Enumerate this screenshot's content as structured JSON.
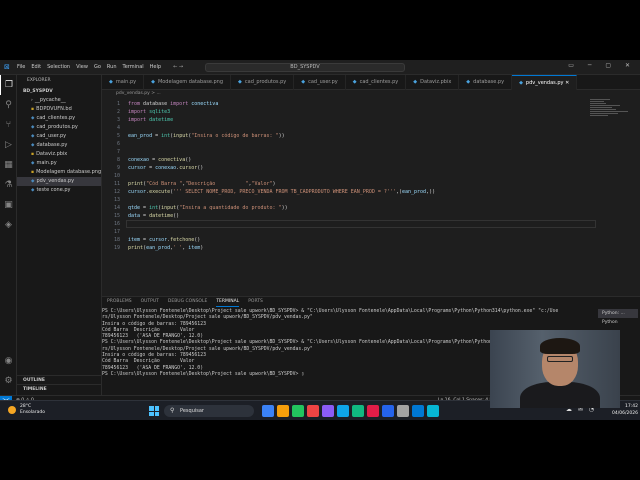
{
  "titlebar": {
    "logo": "⊠",
    "menu": [
      "File",
      "Edit",
      "Selection",
      "View",
      "Go",
      "Run",
      "Terminal",
      "Help"
    ],
    "nav": "←  →",
    "search": "BD_SYSPDV",
    "winctl": "▭ ─ ▢ ✕"
  },
  "activity": {
    "icons": [
      "files-icon",
      "search-icon",
      "source-control-icon",
      "run-debug-icon",
      "extensions-icon",
      "test-icon",
      "remote-icon",
      "docker-icon"
    ],
    "bottom": [
      "account-icon",
      "settings-icon"
    ]
  },
  "sidebar": {
    "header": "EXPLORER",
    "root": "BD_SYSPDV",
    "files": [
      {
        "name": "__pycache__",
        "icon": "›",
        "active": false
      },
      {
        "name": "BDPDVUFN.bd",
        "icon": "▪",
        "active": false
      },
      {
        "name": "cad_clientes.py",
        "icon": "◆",
        "active": false
      },
      {
        "name": "cad_produtos.py",
        "icon": "◆",
        "active": false
      },
      {
        "name": "cad_user.py",
        "icon": "◆",
        "active": false
      },
      {
        "name": "database.py",
        "icon": "◆",
        "active": false
      },
      {
        "name": "Dataviz.pbix",
        "icon": "▪",
        "active": false
      },
      {
        "name": "main.py",
        "icon": "◆",
        "active": false
      },
      {
        "name": "Modelagem database.png",
        "icon": "▪",
        "active": false
      },
      {
        "name": "pdv_vendas.py",
        "icon": "◆",
        "active": true
      },
      {
        "name": "teste cone.py",
        "icon": "◆",
        "active": false
      }
    ],
    "outline": "OUTLINE",
    "timeline": "TIMELINE"
  },
  "tabs": [
    {
      "label": "main.py",
      "active": false
    },
    {
      "label": "Modelagem database.png",
      "active": false
    },
    {
      "label": "cad_produtos.py",
      "active": false
    },
    {
      "label": "cad_user.py",
      "active": false
    },
    {
      "label": "cad_clientes.py",
      "active": false
    },
    {
      "label": "Dataviz.pbix",
      "active": false
    },
    {
      "label": "database.py",
      "active": false
    },
    {
      "label": "pdv_vendas.py  ✕",
      "active": true
    }
  ],
  "breadcrumb": "pdv_vendas.py > ...",
  "code": [
    {
      "n": "1",
      "html": "<span class='kw'>from</span> database <span class='kw'>import</span> <span class='var'>conectiva</span>"
    },
    {
      "n": "2",
      "html": "<span class='kw'>import</span> <span class='cls'>sqlite3</span>"
    },
    {
      "n": "3",
      "html": "<span class='kw'>import</span> <span class='cls'>datetime</span>"
    },
    {
      "n": "4",
      "html": ""
    },
    {
      "n": "5",
      "html": "<span class='var'>ean_prod</span> = <span class='cls'>int</span>(<span class='fn'>input</span>(<span class='str'>\"Insira o código de barras: \"</span>))"
    },
    {
      "n": "6",
      "html": ""
    },
    {
      "n": "7",
      "html": ""
    },
    {
      "n": "8",
      "html": "<span class='var'>conexao</span> = <span class='fn'>conectiva</span>()"
    },
    {
      "n": "9",
      "html": "<span class='var'>cursor</span> = <span class='var'>conexao</span>.<span class='fn'>cursor</span>()"
    },
    {
      "n": "10",
      "html": ""
    },
    {
      "n": "11",
      "html": "<span class='fn'>print</span>(<span class='str'>\"Cód Barra \"</span>,<span class='str'>\"Descrição          \"</span>,<span class='str'>\"Valor\"</span>)"
    },
    {
      "n": "12",
      "html": "<span class='var'>cursor</span>.<span class='fn'>execute</span>(<span class='str'>''' SELECT NOME_PROD, PRECO_VENDA FROM TB_CADPRODUTO WHERE EAN_PROD = ?'''</span>,(<span class='var'>ean_prod</span>,))"
    },
    {
      "n": "13",
      "html": ""
    },
    {
      "n": "14",
      "html": "<span class='var'>qtde</span> = <span class='cls'>int</span>(<span class='fn'>input</span>(<span class='str'>\"Insira a quantidade do produto: \"</span>))"
    },
    {
      "n": "15",
      "html": "<span class='var'>data</span> = <span class='fn'>datetime</span>()"
    },
    {
      "n": "16",
      "html": ""
    },
    {
      "n": "17",
      "html": ""
    },
    {
      "n": "18",
      "html": "<span class='var'>item</span> = <span class='var'>cursor</span>.<span class='fn'>fetchone</span>()"
    },
    {
      "n": "19",
      "html": "<span class='fn'>print</span>(<span class='var'>ean_prod</span>,<span class='str'>' '</span>, <span class='var'>item</span>)"
    }
  ],
  "panel": {
    "tabs": [
      "PROBLEMS",
      "OUTPUT",
      "DEBUG CONSOLE",
      "TERMINAL",
      "PORTS"
    ],
    "active_tab": "TERMINAL",
    "terminal": [
      "PS C:\\Users\\Ulysson Fontenele\\Desktop\\Project sale upwork\\BD_SYSPDV> & \"C:\\Users\\Ulysson Fontenele\\AppData\\Local\\Programs\\Python\\Python314\\python.exe\" \"c:/Use",
      "rs/Ulysson Fontenele/Desktop/Project sale upwork/BD_SYSPDV/pdv_vendas.py\"",
      "Insira o código de barras: 789456123",
      "Cód Barra  Descrição       Valor",
      "789456123   ('ASA DE FRANGO', 12.0)",
      "PS C:\\Users\\Ulysson Fontenele\\Desktop\\Project sale upwork\\BD_SYSPDV> & \"C:\\Users\\Ulysson Fontenele\\AppData\\Local\\Programs\\Python\\Python314\\python.exe\" \"c:/Use",
      "rs/Ulysson Fontenele/Desktop/Project sale upwork/BD_SYSPDV/pdv_vendas.py\"",
      "Insira o código de barras: 789456123",
      "Cód Barra  Descrição       Valor",
      "789456123   ('ASA DE FRANGO', 12.0)",
      "PS C:\\Users\\Ulysson Fontenele\\Desktop\\Project sale upwork\\BD_SYSPDV> ▯"
    ],
    "terminals": [
      {
        "label": "Python: ...",
        "active": true
      },
      {
        "label": "Python",
        "active": false
      }
    ]
  },
  "status": {
    "remote": "><",
    "left": "⊗ 0  ⚠ 0",
    "right": "Ln 16, Col 1   Spaces: 4   UTF-8   CRLF   Python   3.14.0"
  },
  "taskbar": {
    "temp": "28°C",
    "weather": "Ensolarado",
    "search": "Pesquisar",
    "app_colors": [
      "#3b82f6",
      "#f59e0b",
      "#22c55e",
      "#ef4444",
      "#8b5cf6",
      "#0ea5e9",
      "#10b981",
      "#e11d48",
      "#2563eb",
      "#a3a3a3",
      "#0078d4",
      "#06b6d4"
    ],
    "tray": "⌃ ☁ ✉ ◔",
    "time": "17:42",
    "date": "04/06/2026"
  }
}
